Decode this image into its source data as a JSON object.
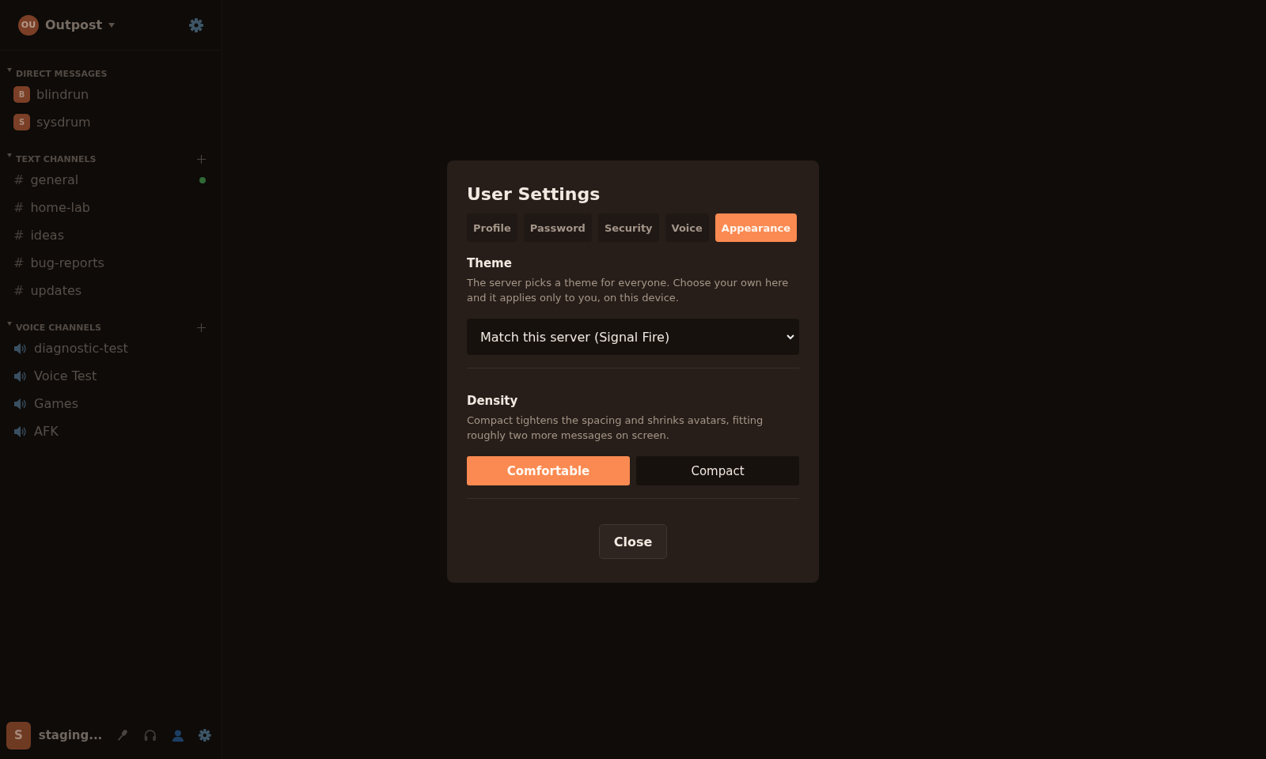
{
  "server": {
    "initials": "OU",
    "name": "Outpost"
  },
  "sections": [
    {
      "kind": "dm",
      "title": "DIRECT MESSAGES",
      "expanded": true,
      "can_add": false,
      "items": [
        {
          "initial": "B",
          "name": "blindrun"
        },
        {
          "initial": "S",
          "name": "sysdrum"
        }
      ]
    },
    {
      "kind": "text",
      "title": "TEXT CHANNELS",
      "expanded": true,
      "can_add": true,
      "items": [
        {
          "symbol": "#",
          "name": "general",
          "unread": true
        },
        {
          "symbol": "#",
          "name": "home-lab",
          "unread": false
        },
        {
          "symbol": "#",
          "name": "ideas",
          "unread": false
        },
        {
          "symbol": "#",
          "name": "bug-reports",
          "unread": false
        },
        {
          "symbol": "#",
          "name": "updates",
          "unread": false
        }
      ]
    },
    {
      "kind": "voice",
      "title": "VOICE CHANNELS",
      "expanded": true,
      "can_add": true,
      "items": [
        {
          "name": "diagnostic-test"
        },
        {
          "name": "Voice Test"
        },
        {
          "name": "Games"
        },
        {
          "name": "AFK"
        }
      ]
    }
  ],
  "user_bar": {
    "initial": "S",
    "name": "staging..."
  },
  "dialog": {
    "title": "User Settings",
    "tabs": [
      {
        "label": "Profile",
        "selected": false
      },
      {
        "label": "Password",
        "selected": false
      },
      {
        "label": "Security",
        "selected": false
      },
      {
        "label": "Voice",
        "selected": false
      },
      {
        "label": "Appearance",
        "selected": true
      }
    ],
    "theme": {
      "heading": "Theme",
      "description": "The server picks a theme for everyone. Choose your own here and it applies only to you, on this device.",
      "value": "Match this server (Signal Fire)"
    },
    "density": {
      "heading": "Density",
      "description": "Compact tightens the spacing and shrinks avatars, fitting roughly two more messages on screen.",
      "options": [
        {
          "label": "Comfortable",
          "selected": true
        },
        {
          "label": "Compact",
          "selected": false
        }
      ]
    },
    "close": "Close"
  }
}
